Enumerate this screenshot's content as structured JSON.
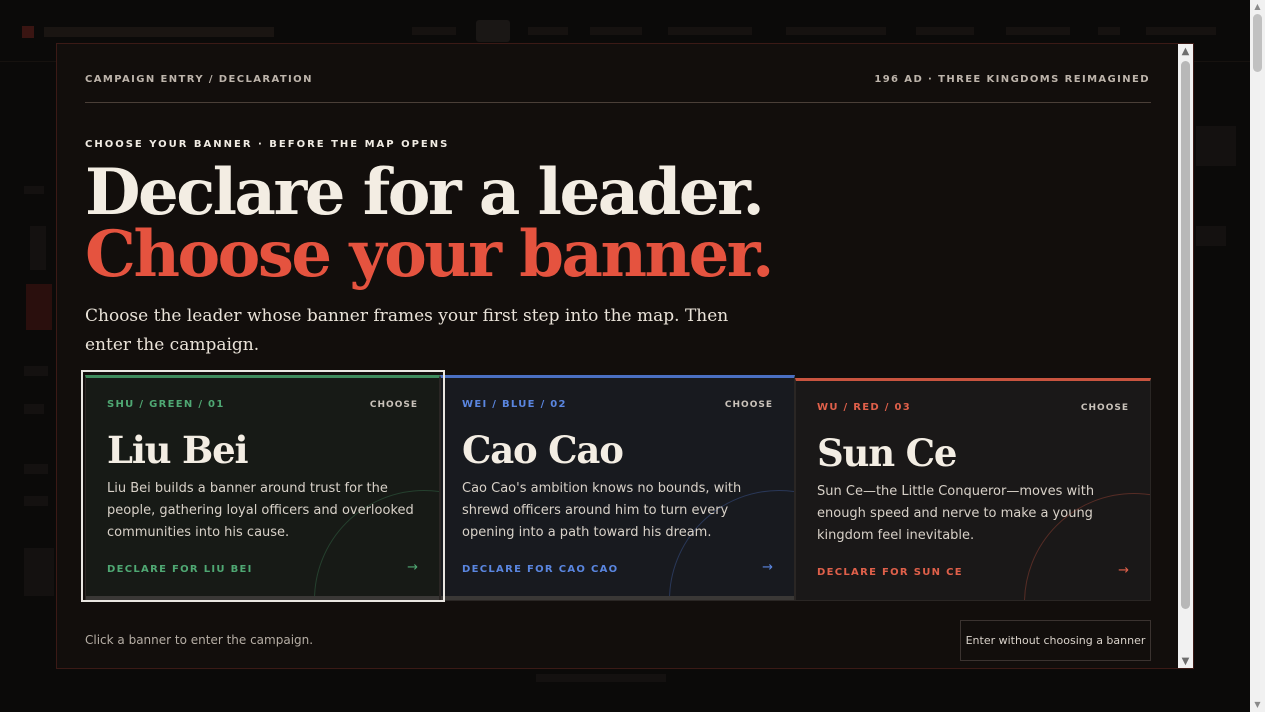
{
  "header": {
    "left_eyebrow": "CAMPAIGN ENTRY / DECLARATION",
    "right_eyebrow": "196 AD · THREE KINGDOMS REIMAGINED"
  },
  "hero": {
    "kicker": "CHOOSE YOUR BANNER · BEFORE THE MAP OPENS",
    "headline_line1": "Declare for a leader.",
    "headline_line2": "Choose your banner.",
    "lede": "Choose the leader whose banner frames your first step into the map. Then enter the campaign."
  },
  "cards": [
    {
      "faction": "shu",
      "tag": "SHU / GREEN / 01",
      "choose_label": "CHOOSE",
      "name": "Liu Bei",
      "description": "Liu Bei builds a banner around trust for the people, gathering loyal officers and overlooked communities into his cause.",
      "declare_label": "DECLARE FOR LIU BEI",
      "arrow": "→",
      "accent": "#3f8a5c"
    },
    {
      "faction": "wei",
      "tag": "WEI / BLUE / 02",
      "choose_label": "CHOOSE",
      "name": "Cao Cao",
      "description": "Cao Cao's ambition knows no bounds, with shrewd officers around him to turn every opening into a path toward his dream.",
      "declare_label": "DECLARE FOR CAO CAO",
      "arrow": "→",
      "accent": "#4a6fc2"
    },
    {
      "faction": "wu",
      "tag": "WU / RED / 03",
      "choose_label": "CHOOSE",
      "name": "Sun Ce",
      "description": "Sun Ce—the Little Conqueror—moves with enough speed and nerve to make a young kingdom feel inevitable.",
      "declare_label": "DECLARE FOR SUN CE",
      "arrow": "→",
      "accent": "#c9543f"
    }
  ],
  "footer": {
    "note": "Click a banner to enter the campaign.",
    "enter_button": "Enter without choosing a banner"
  },
  "colors": {
    "headline_accent": "#e5533f",
    "modal_background": "#120e0c"
  }
}
